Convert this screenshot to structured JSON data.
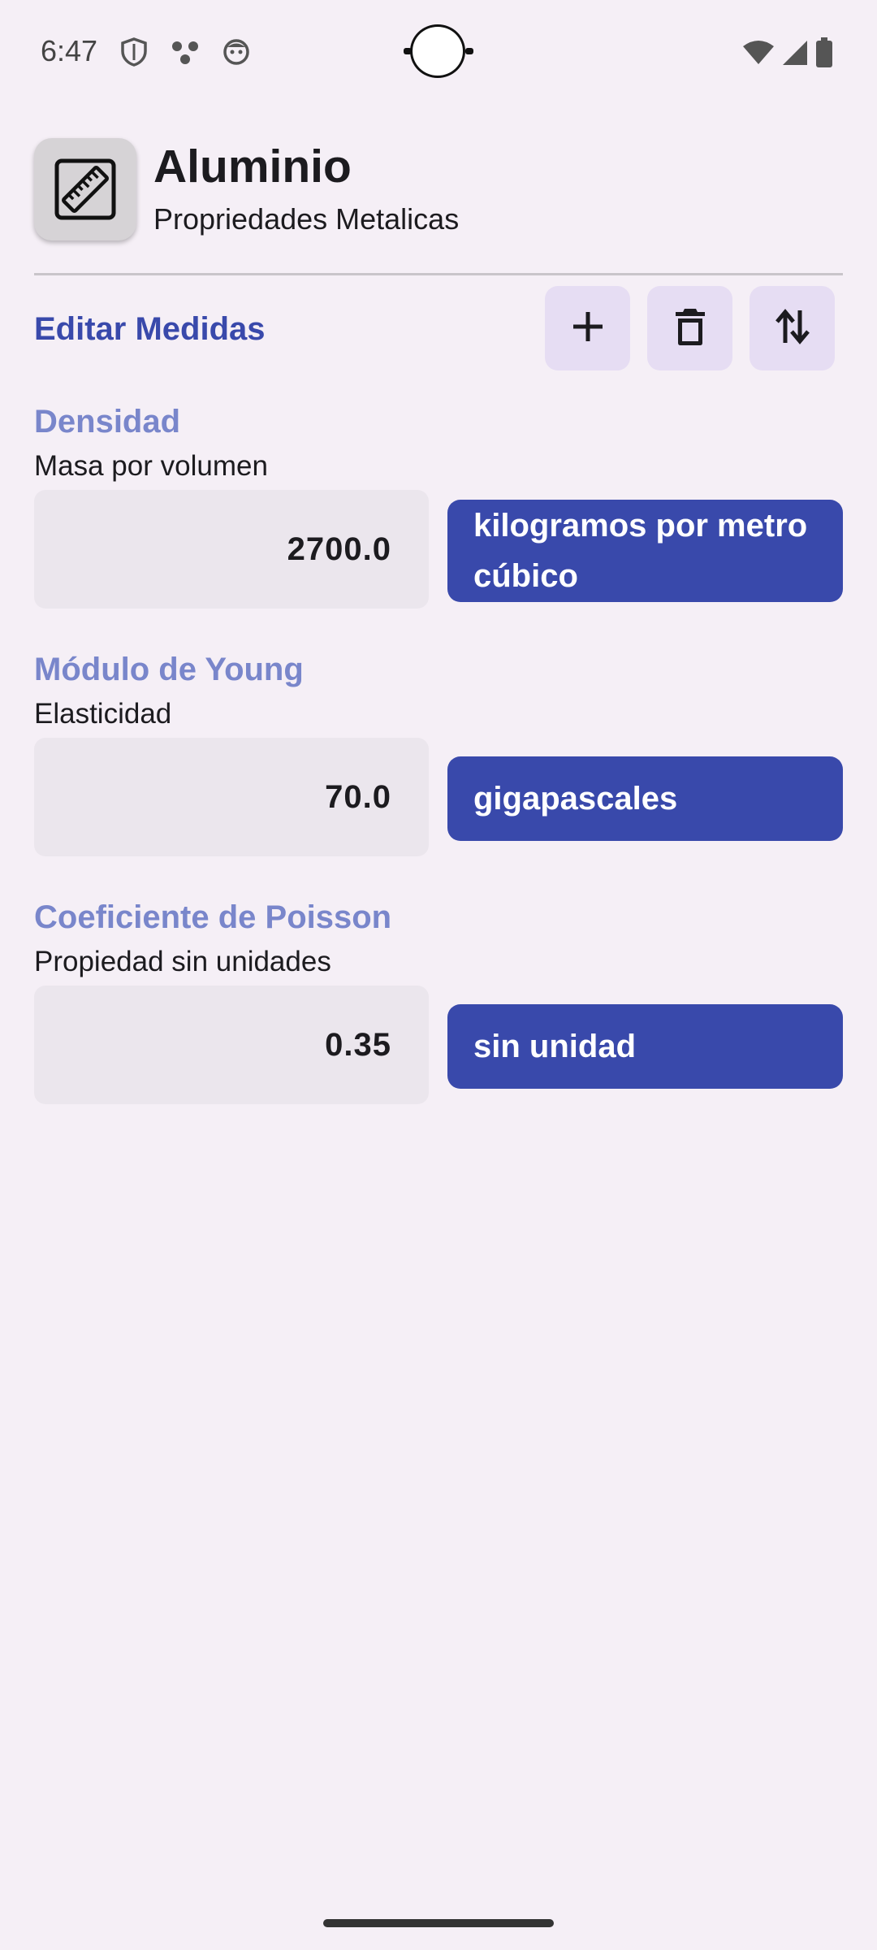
{
  "status_bar": {
    "time": "6:47",
    "left_icons": [
      "shield-icon",
      "dots-icon",
      "face-icon"
    ],
    "right_icons": [
      "wifi-icon",
      "signal-icon",
      "battery-icon"
    ]
  },
  "header": {
    "icon": "ruler-icon",
    "title": "Aluminio",
    "subtitle": "Propriedades Metalicas"
  },
  "toolbar": {
    "title": "Editar Medidas",
    "actions": [
      "add-icon",
      "delete-icon",
      "swap-vertical-icon"
    ]
  },
  "measures": [
    {
      "name": "Densidad",
      "description": "Masa por volumen",
      "value": "2700.0",
      "unit": "kilogramos por metro cúbico"
    },
    {
      "name": "Módulo de Young",
      "description": "Elasticidad",
      "value": "70.0",
      "unit": "gigapascales"
    },
    {
      "name": "Coeficiente de Poisson",
      "description": "Propiedad sin unidades",
      "value": "0.35",
      "unit": "sin unidad"
    }
  ],
  "colors": {
    "background": "#f5eff6",
    "primary": "#3949ab",
    "primary_light": "#7986cb",
    "tonal_button": "#e6ddf3",
    "field_fill": "#ebe6ed"
  }
}
